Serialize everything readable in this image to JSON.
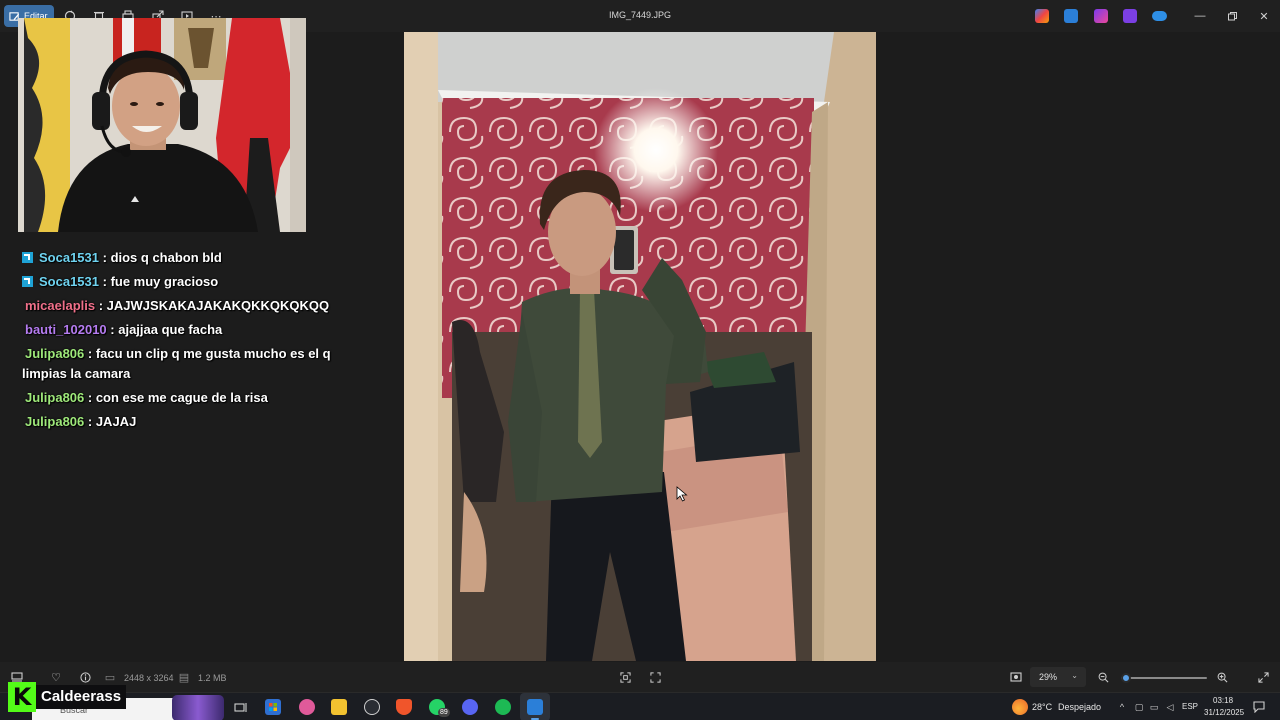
{
  "window": {
    "title": "IMG_7449.JPG",
    "edit_label": "Editar"
  },
  "stream": {
    "chat": [
      {
        "user": "Soca1531",
        "badge": true,
        "color": "#6fd3f0",
        "message": "dios q chabon bld"
      },
      {
        "user": "Soca1531",
        "badge": true,
        "color": "#6fd3f0",
        "message": "fue muy gracioso"
      },
      {
        "user": "micaelaplis",
        "badge": false,
        "color": "#f0708a",
        "message": "JAJWJSKAKAJAKAKQKKQKQKQQ"
      },
      {
        "user": "bauti_102010",
        "badge": false,
        "color": "#b57cf0",
        "message": "ajajjaa que facha"
      },
      {
        "user": "Julipa806",
        "badge": false,
        "color": "#9ee87a",
        "message": "facu un clip q me gusta mucho es el q limpias la camara"
      },
      {
        "user": "Julipa806",
        "badge": false,
        "color": "#9ee87a",
        "message": "con ese me cague de la risa"
      },
      {
        "user": "Julipa806",
        "badge": false,
        "color": "#9ee87a",
        "message": "JAJAJ"
      }
    ],
    "streamer_name": "Caldeerass",
    "kick_letter": "K"
  },
  "statusbar": {
    "dimensions": "2448 x 3264",
    "file_size": "1.2 MB",
    "zoom_value": "29%",
    "zoom_level_fraction": 0.06
  },
  "taskbar": {
    "search_placeholder": "Buscar",
    "whatsapp_badge": "89",
    "weather": "28°C",
    "weather_desc": "Despejado",
    "language": "ESP",
    "time": "03:18",
    "date": "31/12/2025"
  },
  "colors": {
    "accent": "#5aa0e6",
    "kick_green": "#53fc18",
    "title_bg": "#202020",
    "canvas_bg": "#1c1c1c"
  }
}
